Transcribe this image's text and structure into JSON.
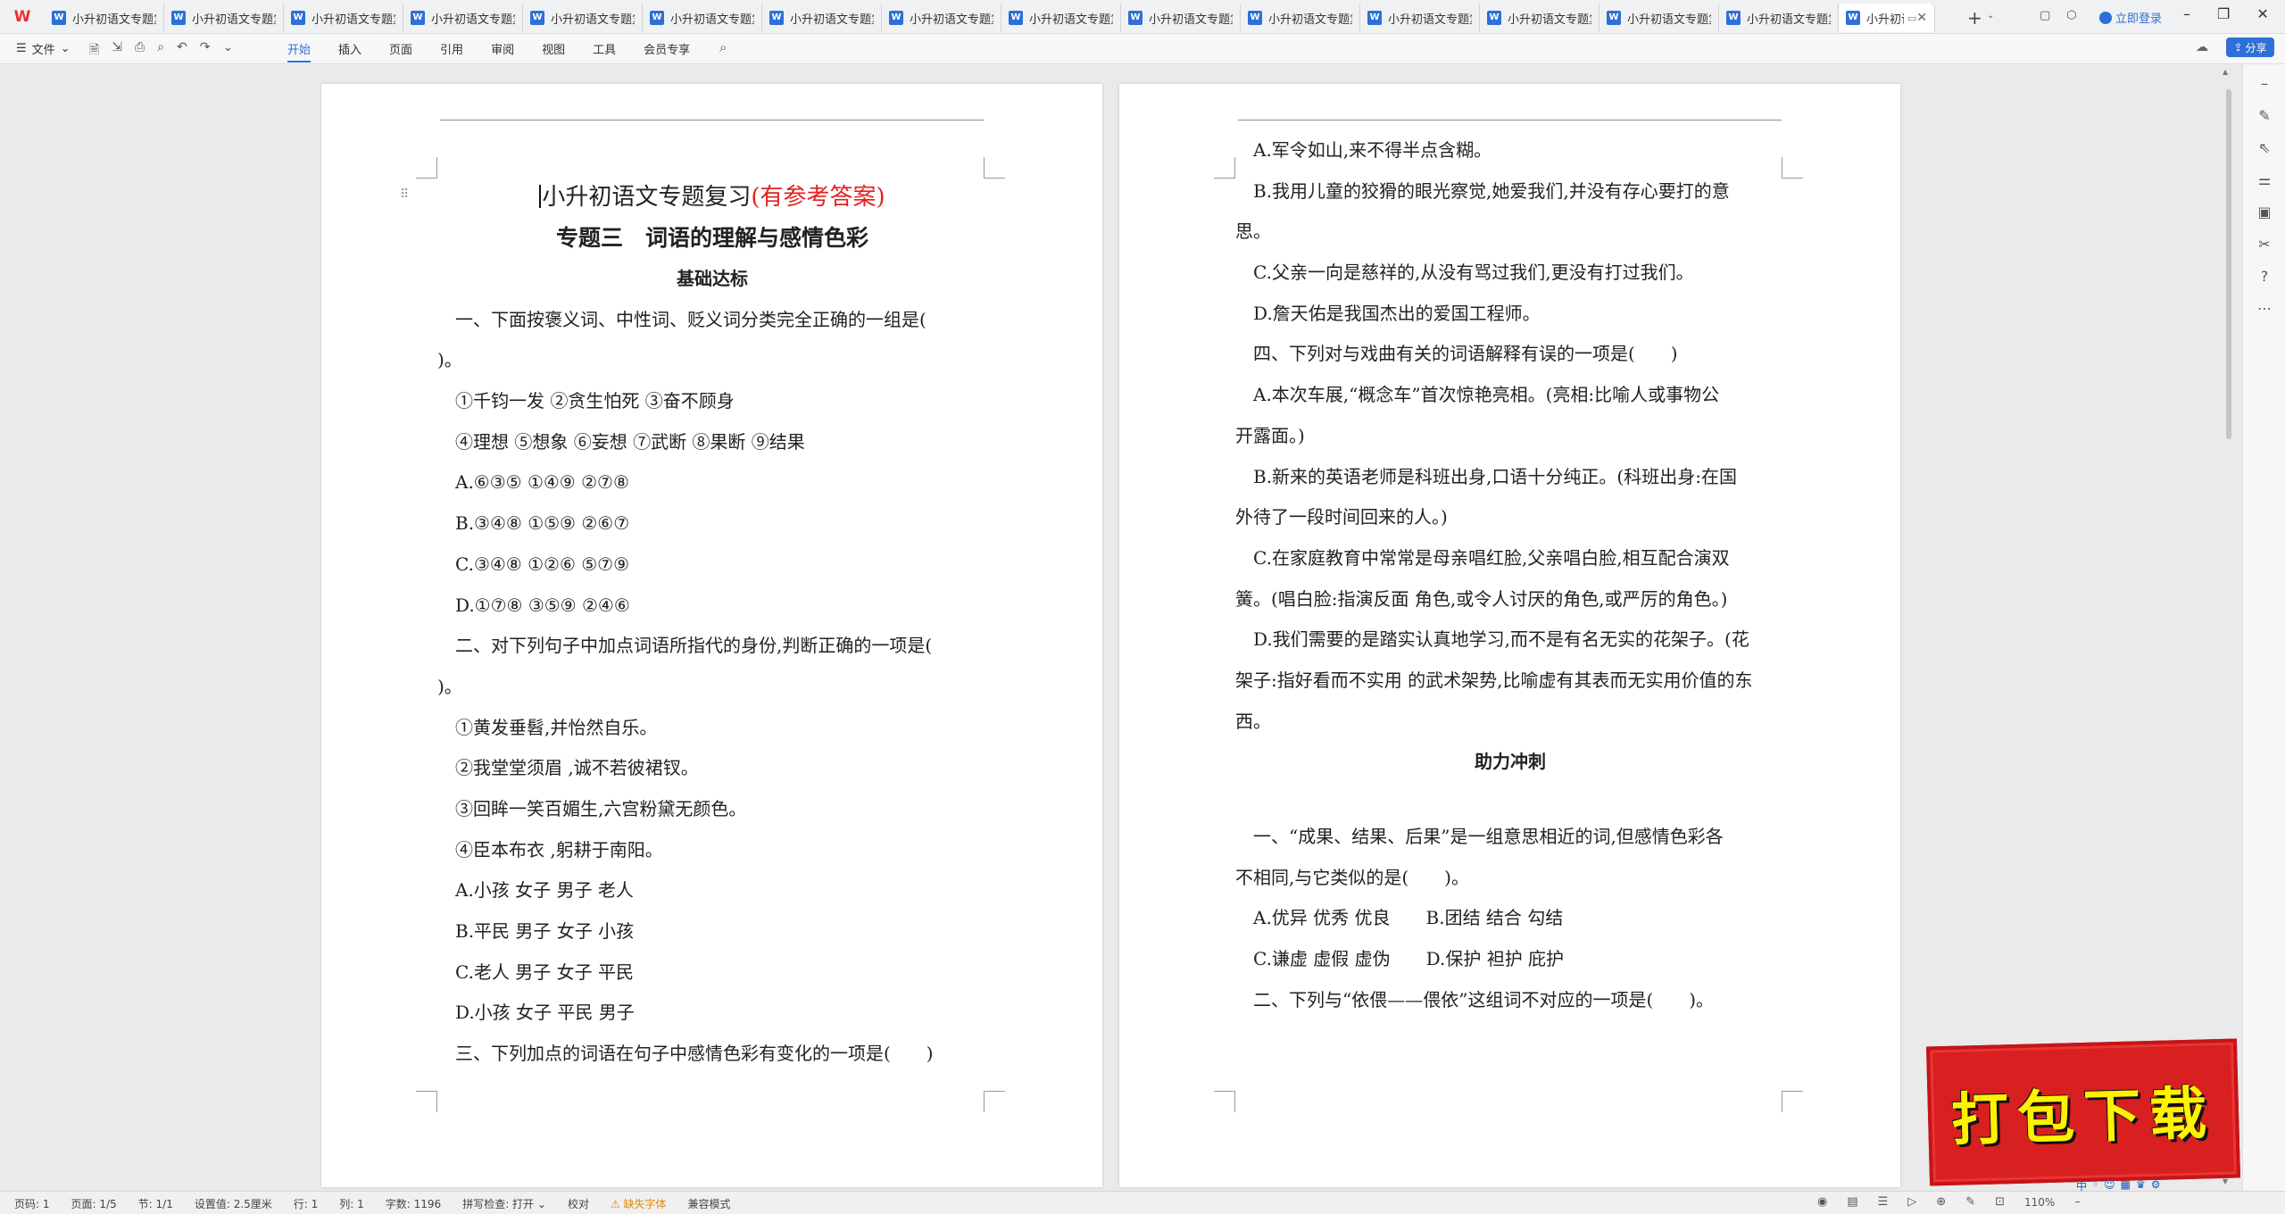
{
  "app": {
    "logo": "W"
  },
  "tabs": [
    {
      "label": "小升初语文专题复习"
    },
    {
      "label": "小升初语文专题复习"
    },
    {
      "label": "小升初语文专题复习"
    },
    {
      "label": "小升初语文专题复习"
    },
    {
      "label": "小升初语文专题复习"
    },
    {
      "label": "小升初语文专题复习"
    },
    {
      "label": "小升初语文专题复习"
    },
    {
      "label": "小升初语文专题复习"
    },
    {
      "label": "小升初语文专题复习"
    },
    {
      "label": "小升初语文专题复习"
    },
    {
      "label": "小升初语文专题复习"
    },
    {
      "label": "小升初语文专题复习"
    },
    {
      "label": "小升初语文专题复习"
    },
    {
      "label": "小升初语文专题复习"
    },
    {
      "label": "小升初语文专题复习"
    }
  ],
  "active_tab": {
    "label": "小升初语",
    "close": "✕"
  },
  "tab_doc_icon": "W",
  "header": {
    "login": "立即登录",
    "new_tab": "+"
  },
  "toolbar": {
    "file_menu": "文件",
    "ribbon_tabs": [
      "开始",
      "插入",
      "页面",
      "引用",
      "审阅",
      "视图",
      "工具",
      "会员专享"
    ],
    "share": "分享"
  },
  "page1": {
    "title_black": "小升初语文专题复习",
    "title_red": "(有参考答案)",
    "subtitle": "专题三　词语的理解与感情色彩",
    "section": "基础达标",
    "lines": [
      "一、下面按褒义词、中性词、贬义词分类完全正确的一组是(",
      ")。",
      "①千钧一发 ②贪生怕死 ③奋不顾身",
      "④理想 ⑤想象 ⑥妄想 ⑦武断 ⑧果断 ⑨结果",
      "A.⑥③⑤ ①④⑨ ②⑦⑧",
      "B.③④⑧ ①⑤⑨ ②⑥⑦",
      "C.③④⑧ ①②⑥ ⑤⑦⑨",
      "D.①⑦⑧ ③⑤⑨ ②④⑥",
      "二、对下列句子中加点词语所指代的身份,判断正确的一项是(",
      ")。",
      "①黄发垂髫,并怡然自乐。",
      "②我堂堂须眉 ,诚不若彼裙钗。",
      "③回眸一笑百媚生,六宫粉黛无颜色。",
      "④臣本布衣 ,躬耕于南阳。",
      "A.小孩  女子  男子  老人",
      "B.平民  男子  女子  小孩",
      "C.老人  男子  女子  平民",
      "D.小孩  女子  平民  男子",
      "三、下列加点的词语在句子中感情色彩有变化的一项是(　　)"
    ]
  },
  "page2": {
    "lines": [
      "A.军令如山,来不得半点含糊。",
      "B.我用儿童的狡猾的眼光察觉,她爱我们,并没有存心要打的意",
      "思。",
      "C.父亲一向是慈祥的,从没有骂过我们,更没有打过我们。",
      "D.詹天佑是我国杰出的爱国工程师。",
      "四、下列对与戏曲有关的词语解释有误的一项是(　　)",
      "A.本次车展,“概念车”首次惊艳亮相。(亮相:比喻人或事物公",
      "开露面。)",
      "B.新来的英语老师是科班出身,口语十分纯正。(科班出身:在国",
      "外待了一段时间回来的人。)",
      "C.在家庭教育中常常是母亲唱红脸,父亲唱白脸,相互配合演双",
      "簧。(唱白脸:指演反面 角色,或令人讨厌的角色,或严厉的角色。)",
      "D.我们需要的是踏实认真地学习,而不是有名无实的花架子。(花",
      "架子:指好看而不实用 的武术架势,比喻虚有其表而无实用价值的东",
      "西。"
    ],
    "section": "助力冲刺",
    "lines_after": [
      "一、“成果、结果、后果”是一组意思相近的词,但感情色彩各",
      "不相同,与它类似的是(　　)。",
      "A.优异  优秀  优良　　B.团结  结合  勾结",
      "C.谦虚  虚假  虚伪　　D.保护  袒护  庇护",
      "二、下列与“依偎——偎依”这组词不对应的一项是(　　)。"
    ]
  },
  "statusbar": {
    "items": [
      "页码: 1",
      "页面: 1/5",
      "节: 1/1",
      "设置值: 2.5厘米",
      "行: 1",
      "列: 1",
      "字数: 1196",
      "拼写检查: 打开 ⌄",
      "校对",
      "⚠ 缺失字体",
      "兼容模式"
    ],
    "zoom": "110%"
  },
  "promo": {
    "text": "打包下载"
  }
}
